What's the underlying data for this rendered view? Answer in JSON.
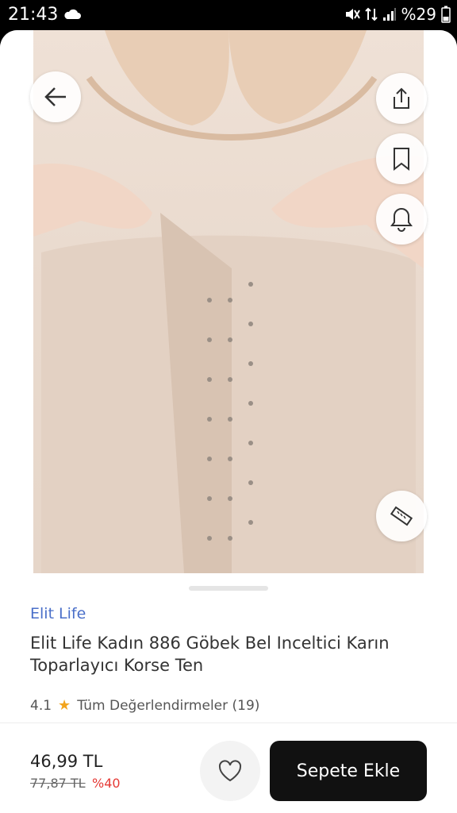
{
  "status_bar": {
    "time": "21:43",
    "battery": "%29"
  },
  "product": {
    "brand": "Elit Life",
    "title": "Elit Life Kadın 886 Göbek Bel Inceltici Karın Toparlayıcı Korse Ten",
    "rating": "4.1",
    "reviews_label": "Tüm Değerlendirmeler (19)"
  },
  "pricing": {
    "price": "46,99 TL",
    "old_price": "77,87 TL",
    "discount": "%40"
  },
  "actions": {
    "add_to_cart": "Sepete Ekle"
  },
  "icons": {
    "back": "arrow-left-icon",
    "share": "share-icon",
    "bookmark": "bookmark-icon",
    "notify": "bell-icon",
    "size": "ruler-icon",
    "favorite": "heart-icon",
    "star": "star-icon"
  },
  "colors": {
    "brand_link": "#4a6fc9",
    "star": "#f2a41d",
    "discount": "#e53935",
    "cta": "#111111"
  }
}
